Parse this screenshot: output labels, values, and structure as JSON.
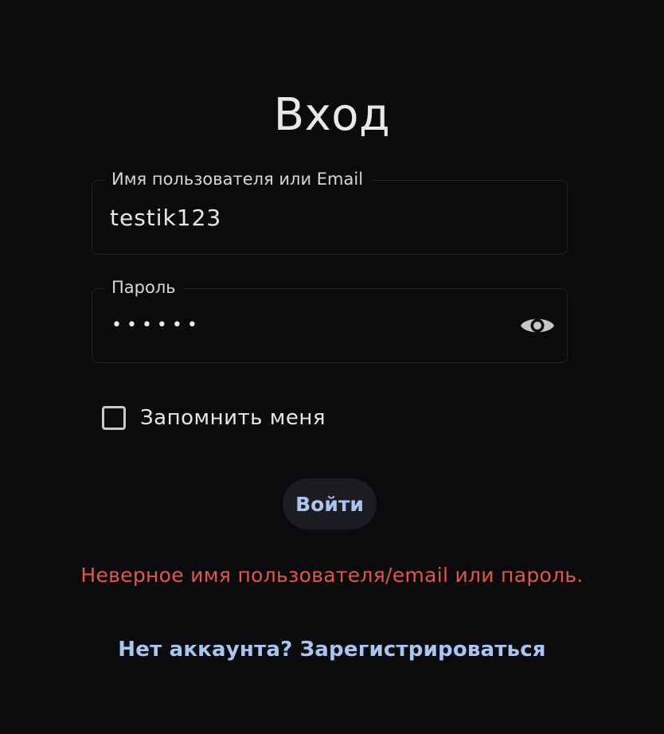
{
  "title": "Вход",
  "form": {
    "username": {
      "label": "Имя пользователя или Email",
      "value": "testik123"
    },
    "password": {
      "label": "Пароль",
      "masked_value": "••••••",
      "toggle_icon": "eye-icon"
    },
    "remember": {
      "label": "Запомнить меня",
      "checked": false
    },
    "submit_label": "Войти"
  },
  "error_message": "Неверное имя пользователя/email или пароль.",
  "register_link": "Нет аккаунта? Зарегистрироваться",
  "colors": {
    "background": "#0b0b0d",
    "accent": "#a9c6f3",
    "error": "#e2574c",
    "button_bg": "#1b1d22"
  }
}
